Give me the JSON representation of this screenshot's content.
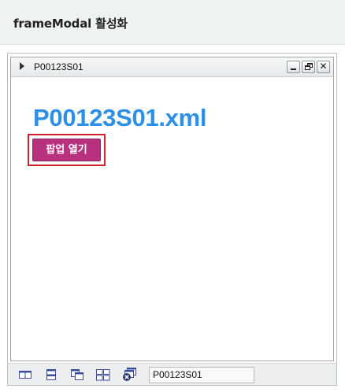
{
  "header": {
    "title": "frameModal 활성화"
  },
  "window": {
    "title": "P00123S01",
    "controls": {
      "minimize_icon": "minimize-icon",
      "restore_icon": "restore-icon",
      "close_glyph": "✕"
    }
  },
  "content": {
    "heading": "P00123S01.xml",
    "popup_button_label": "팝업 열기"
  },
  "taskbar": {
    "icons": [
      "tile-vertical-icon",
      "tile-horizontal-icon",
      "cascade-icon",
      "tile-grid-icon",
      "close-all-icon"
    ],
    "active_window": "P00123S01"
  },
  "colors": {
    "heading": "#2e8fe6",
    "button_bg": "#b8317f",
    "highlight_border": "#cf2430",
    "header_bg": "#eff2f3"
  }
}
